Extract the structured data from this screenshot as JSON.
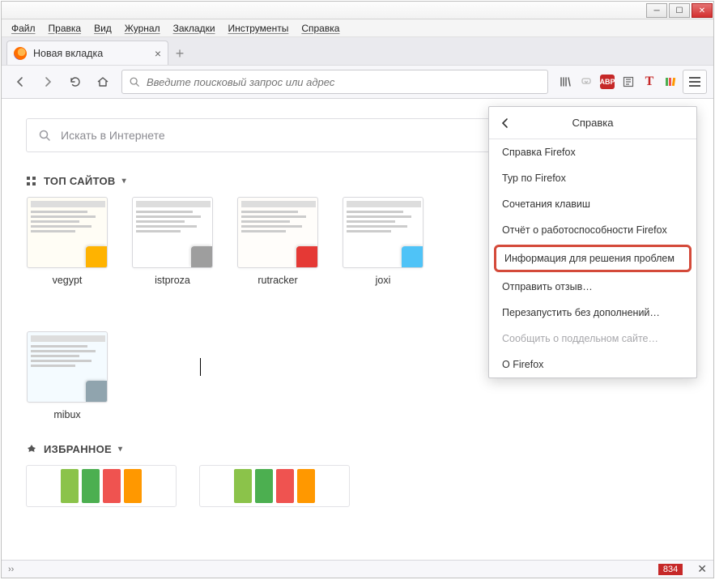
{
  "menubar": {
    "items": [
      "Файл",
      "Правка",
      "Вид",
      "Журнал",
      "Закладки",
      "Инструменты",
      "Справка"
    ]
  },
  "tab": {
    "title": "Новая вкладка",
    "new_tab_tooltip": "+"
  },
  "urlbar": {
    "placeholder": "Введите поисковый запрос или адрес"
  },
  "toolbar_icons": [
    "library",
    "pocket",
    "abp",
    "reader",
    "t-ext",
    "books",
    "menu"
  ],
  "content": {
    "search_placeholder": "Искать в Интернете",
    "top_sites_label": "ТОП САЙТОВ",
    "sites": [
      {
        "label": "vegypt",
        "corner": "#ffb300",
        "thumb_bg": "#fffdf5"
      },
      {
        "label": "istproza",
        "corner": "#9e9e9e",
        "thumb_bg": "#ffffff"
      },
      {
        "label": "rutracker",
        "corner": "#e53935",
        "thumb_bg": "#fffdfa"
      },
      {
        "label": "joxi",
        "corner": "#4fc3f7",
        "thumb_bg": "#ffffff"
      },
      {
        "label": "mibux",
        "corner": "#90a4ae",
        "thumb_bg": "#f4fbff"
      }
    ],
    "favorites_label": "ИЗБРАННОЕ",
    "book_colors": [
      "#8bc34a",
      "#4caf50",
      "#ef5350",
      "#ff9800"
    ]
  },
  "help_panel": {
    "title": "Справка",
    "items": [
      {
        "label": "Справка Firefox",
        "disabled": false
      },
      {
        "label": "Тур по Firefox",
        "disabled": false
      },
      {
        "label": "Сочетания клавиш",
        "disabled": false
      },
      {
        "label": "Отчёт о работоспособности Firefox",
        "disabled": false
      },
      {
        "label": "Информация для решения проблем",
        "disabled": false,
        "highlight": true
      },
      {
        "label": "Отправить отзыв…",
        "disabled": false
      },
      {
        "label": "Перезапустить без дополнений…",
        "disabled": false
      },
      {
        "label": "Сообщить о поддельном сайте…",
        "disabled": true
      },
      {
        "label": "О Firefox",
        "disabled": false
      }
    ]
  },
  "statusbar": {
    "number": "834"
  }
}
